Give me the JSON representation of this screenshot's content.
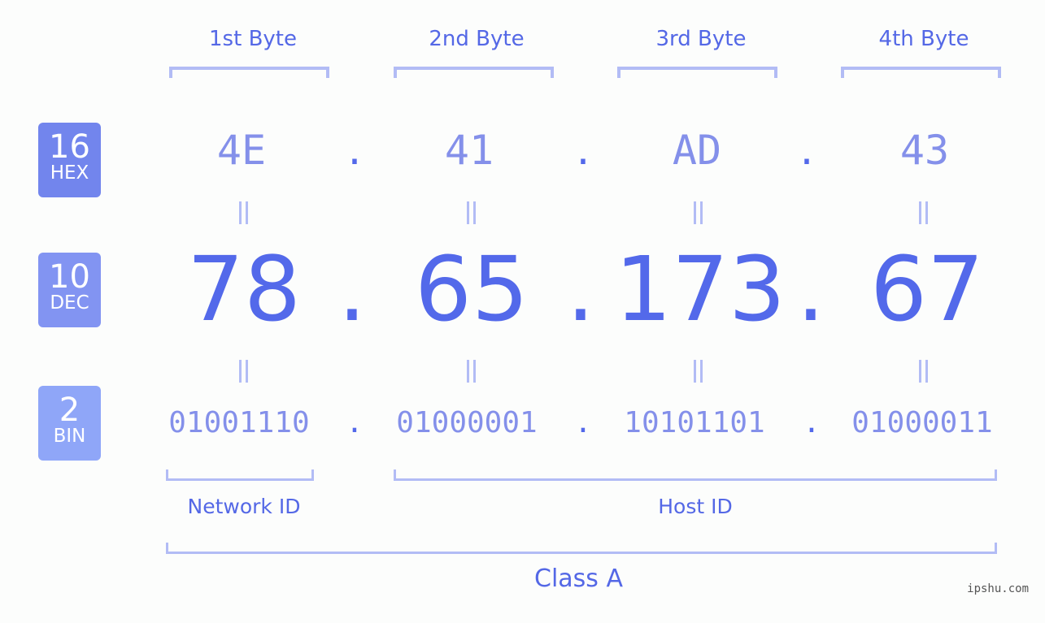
{
  "bytes": [
    {
      "label": "1st Byte",
      "hex": "4E",
      "dec": "78",
      "bin": "01001110"
    },
    {
      "label": "2nd Byte",
      "hex": "41",
      "dec": "65",
      "bin": "01000001"
    },
    {
      "label": "3rd Byte",
      "hex": "AD",
      "dec": "173",
      "bin": "10101101"
    },
    {
      "label": "4th Byte",
      "hex": "43",
      "dec": "67",
      "bin": "01000011"
    }
  ],
  "separator": ".",
  "badges": {
    "hex": {
      "num": "16",
      "label": "HEX"
    },
    "dec": {
      "num": "10",
      "label": "DEC"
    },
    "bin": {
      "num": "2",
      "label": "BIN"
    }
  },
  "groups": {
    "network": "Network ID",
    "host": "Host ID",
    "class": "Class A"
  },
  "watermark": "ipshu.com",
  "colors": {
    "accent": "#5369ea",
    "hex_badge": "#7285ed",
    "dec_badge": "#8294f2",
    "bin_badge": "#8fa6f8",
    "bracket": "#b2bcf5"
  }
}
